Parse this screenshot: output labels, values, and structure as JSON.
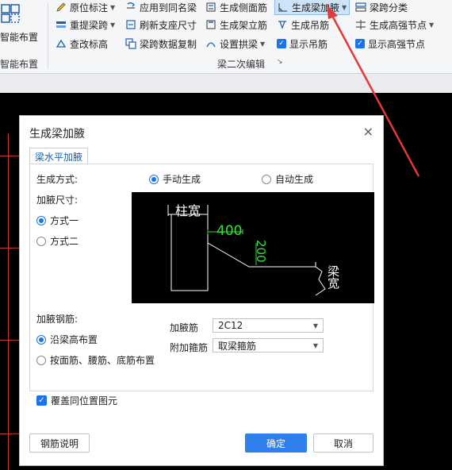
{
  "ribbon": {
    "left_group": {
      "title": "智能布置",
      "label": "智能布置"
    },
    "col1": [
      {
        "label": "原位标注",
        "icon": "pencil-icon",
        "has_caret": true
      },
      {
        "label": "重提梁跨",
        "icon": "redo-span-icon",
        "has_caret": true
      },
      {
        "label": "查改标高",
        "icon": "elevation-icon",
        "has_caret": false
      }
    ],
    "col2": [
      {
        "label": "应用到同名梁",
        "icon": "apply-same-icon"
      },
      {
        "label": "刷新支座尺寸",
        "icon": "refresh-icon"
      },
      {
        "label": "梁跨数据复制",
        "icon": "copy-icon"
      }
    ],
    "col3": [
      {
        "label": "生成侧面筋",
        "icon": "side-rebar-icon"
      },
      {
        "label": "生成架立筋",
        "icon": "erect-rebar-icon"
      },
      {
        "label": "设置拱梁",
        "icon": "arch-beam-icon",
        "has_caret": true
      }
    ],
    "col4": [
      {
        "label": "生成梁加腋",
        "icon": "haunch-icon",
        "has_caret": true,
        "active": true
      },
      {
        "label": "生成吊筋",
        "icon": "hanger-icon"
      },
      {
        "label": "显示吊筋",
        "icon": "checkbox-icon",
        "checked": true
      }
    ],
    "col5": [
      {
        "label": "梁跨分类",
        "icon": "classify-icon"
      },
      {
        "label": "生成高强节点",
        "icon": "node-icon",
        "has_caret": true
      },
      {
        "label": "显示高强节点",
        "icon": "checkbox-icon",
        "checked": true
      }
    ],
    "group_title": "梁二次编辑"
  },
  "dialog": {
    "title": "生成梁加腋",
    "close": "×",
    "tab": "梁水平加腋",
    "gen_mode_label": "生成方式:",
    "gen_modes": [
      {
        "label": "手动生成",
        "selected": true
      },
      {
        "label": "自动生成",
        "selected": false
      }
    ],
    "size_label": "加腋尺寸:",
    "size_modes": [
      {
        "label": "方式一",
        "selected": true
      },
      {
        "label": "方式二",
        "selected": false
      }
    ],
    "preview": {
      "column_width": "柱宽",
      "dim_400": "400",
      "dim_200": "200",
      "beam_width": "梁宽"
    },
    "rebar_label": "加腋钢筋:",
    "rebar_modes": [
      {
        "label": "沿梁高布置",
        "selected": true
      },
      {
        "label": "按面筋、腰筋、底筋布置",
        "selected": false
      }
    ],
    "haunch_rebar_label": "加腋筋",
    "haunch_rebar_value": "2C12",
    "extra_stirrup_label": "附加箍筋",
    "extra_stirrup_value": "取梁箍筋",
    "overwrite_label": "覆盖同位置图元",
    "overwrite_checked": true,
    "help_button": "钢筋说明",
    "ok_button": "确定",
    "cancel_button": "取消"
  },
  "colors": {
    "accent": "#2f80ed",
    "annotation_arrow": "#e53935",
    "preview_green": "#33e033"
  }
}
